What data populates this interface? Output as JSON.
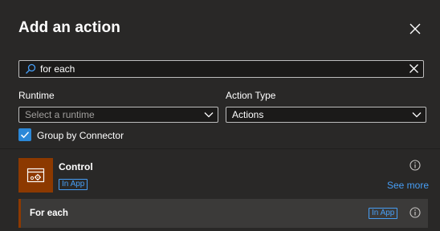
{
  "panel": {
    "title": "Add an action"
  },
  "search": {
    "value": "for each",
    "placeholder": ""
  },
  "filters": {
    "runtime_label": "Runtime",
    "runtime_placeholder": "Select a runtime",
    "action_type_label": "Action Type",
    "action_type_value": "Actions"
  },
  "group_by": {
    "label": "Group by Connector",
    "checked": true
  },
  "connector": {
    "name": "Control",
    "badge": "In App",
    "see_more": "See more",
    "icon": "control-gear-icon",
    "color": "#8c3900"
  },
  "results": [
    {
      "label": "For each",
      "badge": "In App"
    }
  ],
  "colors": {
    "background": "#292827",
    "accent": "#479ef5",
    "checkbox": "#2b88d8",
    "connector": "#8c3900"
  }
}
